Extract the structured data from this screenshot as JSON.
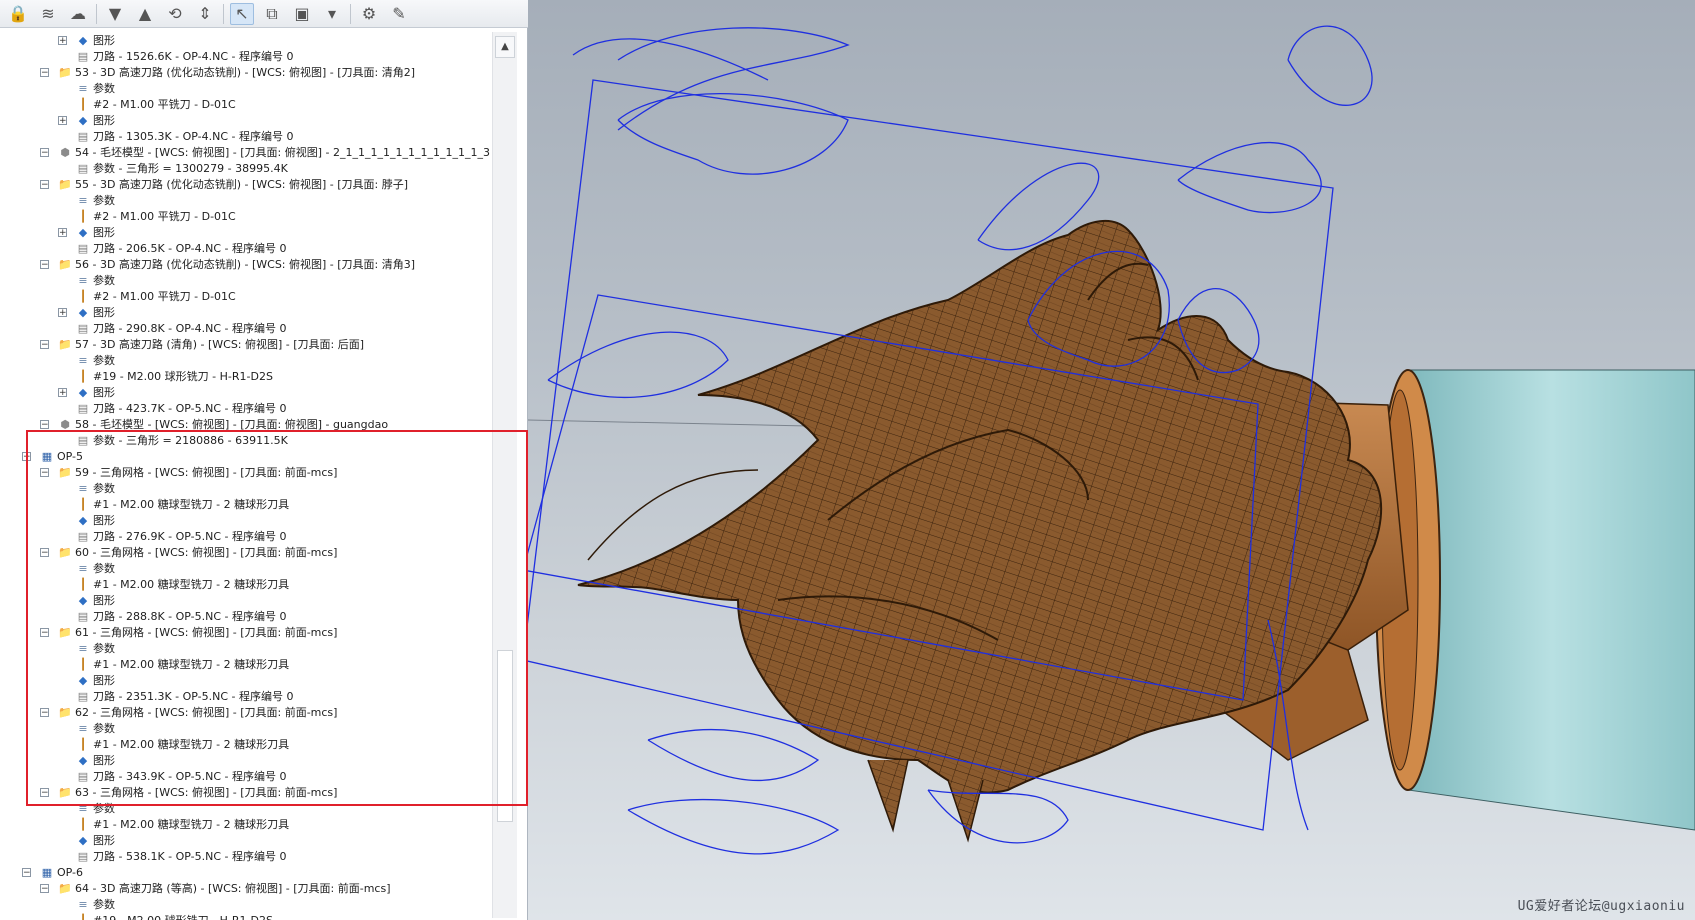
{
  "toolbar": {
    "buttons": [
      {
        "icon": "lock-icon",
        "glyph": "🔒"
      },
      {
        "icon": "wave-icon",
        "glyph": "≋"
      },
      {
        "icon": "ghost-icon",
        "glyph": "☁"
      },
      {
        "icon": "move-down-icon",
        "glyph": "▼"
      },
      {
        "icon": "move-up-icon",
        "glyph": "▲"
      },
      {
        "icon": "loop-icon",
        "glyph": "⟲"
      },
      {
        "icon": "expand-collapse-icon",
        "glyph": "⇕"
      },
      {
        "icon": "select-cursor-icon",
        "glyph": "↖"
      },
      {
        "icon": "copy-shape-icon",
        "glyph": "⧉"
      },
      {
        "icon": "display-options-icon",
        "glyph": "▣"
      },
      {
        "icon": "dropdown-icon",
        "glyph": "▾"
      },
      {
        "icon": "user-settings-icon",
        "glyph": "⚙"
      },
      {
        "icon": "edit-tools-icon",
        "glyph": "✎"
      }
    ]
  },
  "tree": [
    {
      "level": 3,
      "pm": "+",
      "icon": "shape",
      "text": "图形"
    },
    {
      "level": 3,
      "pm": "",
      "icon": "path",
      "text": "刀路 - 1526.6K - OP-4.NC - 程序编号 0"
    },
    {
      "level": 2,
      "pm": "-",
      "icon": "folder",
      "text": "53 - 3D 高速刀路 (优化动态铣削) - [WCS: 俯视图] - [刀具面: 清角2]"
    },
    {
      "level": 3,
      "pm": "",
      "icon": "params",
      "text": "参数"
    },
    {
      "level": 3,
      "pm": "",
      "icon": "tool",
      "text": "#2 - M1.00 平铣刀 - D-01C"
    },
    {
      "level": 3,
      "pm": "+",
      "icon": "shape",
      "text": "图形"
    },
    {
      "level": 3,
      "pm": "",
      "icon": "path",
      "text": "刀路 - 1305.3K - OP-4.NC - 程序编号 0"
    },
    {
      "level": 2,
      "pm": "-",
      "icon": "stock",
      "text": "54 - 毛坯模型 - [WCS: 俯视图] - [刀具面: 俯视图] - 2_1_1_1_1_1_1_1_1_1_1_1_3"
    },
    {
      "level": 3,
      "pm": "",
      "icon": "path",
      "text": "参数 - 三角形 =  1300279 - 38995.4K"
    },
    {
      "level": 2,
      "pm": "-",
      "icon": "folder",
      "text": "55 - 3D 高速刀路 (优化动态铣削) - [WCS: 俯视图] - [刀具面: 脖子]"
    },
    {
      "level": 3,
      "pm": "",
      "icon": "params",
      "text": "参数"
    },
    {
      "level": 3,
      "pm": "",
      "icon": "tool",
      "text": "#2 - M1.00 平铣刀 - D-01C"
    },
    {
      "level": 3,
      "pm": "+",
      "icon": "shape",
      "text": "图形"
    },
    {
      "level": 3,
      "pm": "",
      "icon": "path",
      "text": "刀路 - 206.5K - OP-4.NC - 程序编号 0"
    },
    {
      "level": 2,
      "pm": "-",
      "icon": "folder",
      "text": "56 - 3D 高速刀路 (优化动态铣削) - [WCS: 俯视图] - [刀具面: 清角3]"
    },
    {
      "level": 3,
      "pm": "",
      "icon": "params",
      "text": "参数"
    },
    {
      "level": 3,
      "pm": "",
      "icon": "tool",
      "text": "#2 - M1.00 平铣刀 - D-01C"
    },
    {
      "level": 3,
      "pm": "+",
      "icon": "shape",
      "text": "图形"
    },
    {
      "level": 3,
      "pm": "",
      "icon": "path",
      "text": "刀路 - 290.8K - OP-4.NC - 程序编号 0"
    },
    {
      "level": 2,
      "pm": "-",
      "icon": "folder",
      "text": "57 - 3D 高速刀路 (清角) - [WCS: 俯视图] - [刀具面: 后面]"
    },
    {
      "level": 3,
      "pm": "",
      "icon": "params",
      "text": "参数"
    },
    {
      "level": 3,
      "pm": "",
      "icon": "tool",
      "text": "#19 - M2.00 球形铣刀 - H-R1-D2S"
    },
    {
      "level": 3,
      "pm": "+",
      "icon": "shape",
      "text": "图形"
    },
    {
      "level": 3,
      "pm": "",
      "icon": "path",
      "text": "刀路 - 423.7K - OP-5.NC - 程序编号 0"
    },
    {
      "level": 2,
      "pm": "-",
      "icon": "stock",
      "text": "58 - 毛坯模型 - [WCS: 俯视图] - [刀具面: 俯视图] - guangdao"
    },
    {
      "level": 3,
      "pm": "",
      "icon": "path",
      "text": "参数 - 三角形 =  2180886 - 63911.5K"
    },
    {
      "level": 1,
      "pm": "-",
      "icon": "op",
      "text": "OP-5"
    },
    {
      "level": 2,
      "pm": "-",
      "icon": "folder",
      "text": "59 - 三角网格 - [WCS: 俯视图] - [刀具面: 前面-mcs]"
    },
    {
      "level": 3,
      "pm": "",
      "icon": "params",
      "text": "参数"
    },
    {
      "level": 3,
      "pm": "",
      "icon": "tool",
      "text": "#1 - M2.00 糖球型铣刀 - 2 糖球形刀具"
    },
    {
      "level": 3,
      "pm": "",
      "icon": "shape",
      "text": "图形"
    },
    {
      "level": 3,
      "pm": "",
      "icon": "path",
      "text": "刀路 - 276.9K - OP-5.NC - 程序编号 0"
    },
    {
      "level": 2,
      "pm": "-",
      "icon": "folder",
      "text": "60 - 三角网格 - [WCS: 俯视图] - [刀具面: 前面-mcs]"
    },
    {
      "level": 3,
      "pm": "",
      "icon": "params",
      "text": "参数"
    },
    {
      "level": 3,
      "pm": "",
      "icon": "tool",
      "text": "#1 - M2.00 糖球型铣刀 - 2 糖球形刀具"
    },
    {
      "level": 3,
      "pm": "",
      "icon": "shape",
      "text": "图形"
    },
    {
      "level": 3,
      "pm": "",
      "icon": "path",
      "text": "刀路 - 288.8K - OP-5.NC - 程序编号 0"
    },
    {
      "level": 2,
      "pm": "-",
      "icon": "folder",
      "text": "61 - 三角网格 - [WCS: 俯视图] - [刀具面: 前面-mcs]"
    },
    {
      "level": 3,
      "pm": "",
      "icon": "params",
      "text": "参数"
    },
    {
      "level": 3,
      "pm": "",
      "icon": "tool",
      "text": "#1 - M2.00 糖球型铣刀 - 2 糖球形刀具"
    },
    {
      "level": 3,
      "pm": "",
      "icon": "shape",
      "text": "图形"
    },
    {
      "level": 3,
      "pm": "",
      "icon": "path",
      "text": "刀路 - 2351.3K - OP-5.NC - 程序编号 0"
    },
    {
      "level": 2,
      "pm": "-",
      "icon": "folder",
      "text": "62 - 三角网格 - [WCS: 俯视图] - [刀具面: 前面-mcs]"
    },
    {
      "level": 3,
      "pm": "",
      "icon": "params",
      "text": "参数"
    },
    {
      "level": 3,
      "pm": "",
      "icon": "tool",
      "text": "#1 - M2.00 糖球型铣刀 - 2 糖球形刀具"
    },
    {
      "level": 3,
      "pm": "",
      "icon": "shape",
      "text": "图形"
    },
    {
      "level": 3,
      "pm": "",
      "icon": "path",
      "text": "刀路 - 343.9K - OP-5.NC - 程序编号 0"
    },
    {
      "level": 2,
      "pm": "-",
      "icon": "folder",
      "text": "63 - 三角网格 - [WCS: 俯视图] - [刀具面: 前面-mcs]"
    },
    {
      "level": 3,
      "pm": "",
      "icon": "params",
      "text": "参数"
    },
    {
      "level": 3,
      "pm": "",
      "icon": "tool",
      "text": "#1 - M2.00 糖球型铣刀 - 2 糖球形刀具"
    },
    {
      "level": 3,
      "pm": "",
      "icon": "shape",
      "text": "图形"
    },
    {
      "level": 3,
      "pm": "",
      "icon": "path",
      "text": "刀路 - 538.1K - OP-5.NC - 程序编号 0"
    },
    {
      "level": 1,
      "pm": "-",
      "icon": "op",
      "text": "OP-6"
    },
    {
      "level": 2,
      "pm": "-",
      "icon": "folder",
      "text": "64 - 3D 高速刀路 (等高) - [WCS: 俯视图] - [刀具面: 前面-mcs]"
    },
    {
      "level": 3,
      "pm": "",
      "icon": "params",
      "text": "参数"
    },
    {
      "level": 3,
      "pm": "",
      "icon": "tool",
      "text": "#19 - M2.00 球形铣刀 - H-R1-D2S"
    }
  ],
  "viewport": {
    "watermark": "UG爱好者论坛@ugxiaoniu",
    "colors": {
      "toolpath": "#1f2fe0",
      "model": "#8a5a2e",
      "model_dark": "#4a2c12",
      "fixture": "#b5723c",
      "cylinder": "#9fcfd2"
    }
  },
  "highlight": {
    "color": "#e0202b"
  }
}
